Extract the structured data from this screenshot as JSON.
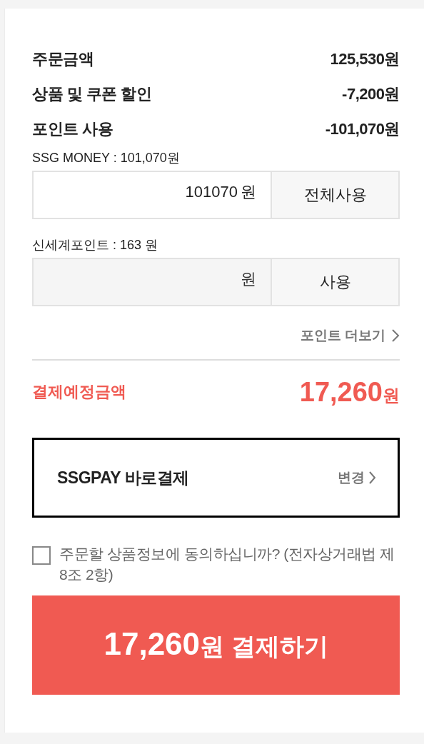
{
  "summary": [
    {
      "label": "주문금액",
      "value": "125,530원"
    },
    {
      "label": "상품 및 쿠폰 할인",
      "value": "-7,200원"
    },
    {
      "label": "포인트 사용",
      "value": "-101,070원"
    }
  ],
  "points": [
    {
      "label": "SSG MONEY : 101,070원",
      "value": "101070",
      "unit": "원",
      "disabled": false,
      "button": "전체사용"
    },
    {
      "label": "신세계포인트 : 163 원",
      "unit": "원",
      "disabled": true,
      "button": "사용"
    }
  ],
  "more_points_link": "포인트 더보기",
  "total": {
    "label": "결제예정금액",
    "amount": "17,260",
    "unit": "원"
  },
  "payment_method": {
    "name": "SSGPAY 바로결제",
    "change": "변경"
  },
  "agreement": {
    "text": "주문할 상품정보에 동의하십니까? (전자상거래법 제8조 2항)",
    "checked": false
  },
  "pay_button": {
    "amount": "17,260",
    "unit": "원",
    "action": "결제하기"
  }
}
